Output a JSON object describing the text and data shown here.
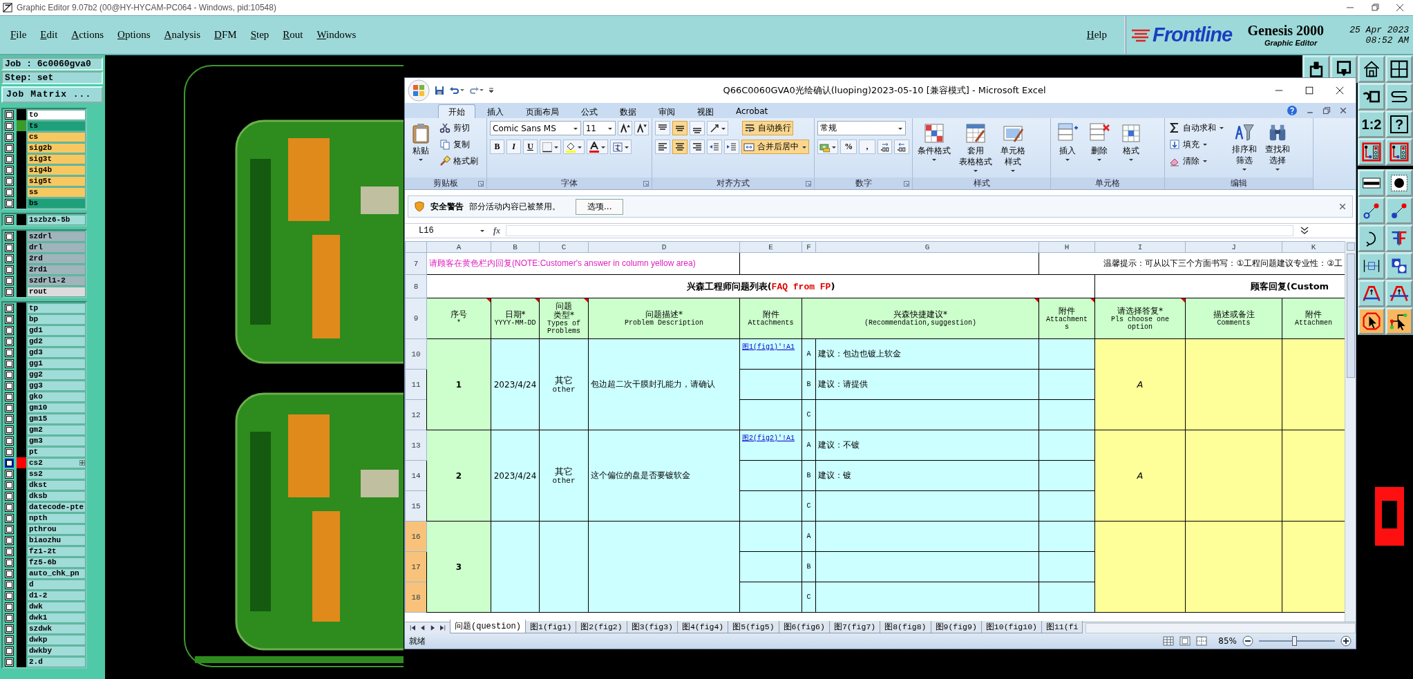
{
  "genesis": {
    "title": "Graphic Editor 9.07b2 (00@HY-HYCAM-PC064 - Windows, pid:10548)",
    "menu": [
      "File",
      "Edit",
      "Actions",
      "Options",
      "Analysis",
      "DFM",
      "Step",
      "Rout",
      "Windows"
    ],
    "help": "Help",
    "brand": {
      "logo": "Frontline",
      "product": "Genesis 2000",
      "subtitle": "Graphic Editor",
      "date": "25 Apr 2023",
      "time": "08:52 AM"
    },
    "job": "Job : 6c0060gva0",
    "step": "Step: set",
    "job_matrix": "Job Matrix ...",
    "layer_groups": [
      [
        {
          "name": "to",
          "color": "#ffffff",
          "checked": false,
          "selected": false
        },
        {
          "name": "ts",
          "color": "#1fa07a",
          "marker": {
            "color": "#3a9a2a"
          },
          "checked": false,
          "selected": false
        },
        {
          "name": "cs",
          "color": "#f8c860",
          "checked": false,
          "selected": false
        },
        {
          "name": "sig2b",
          "color": "#f8c860",
          "checked": false,
          "selected": false
        },
        {
          "name": "sig3t",
          "color": "#f8c860",
          "checked": false,
          "selected": false
        },
        {
          "name": "sig4b",
          "color": "#f8c860",
          "checked": false,
          "selected": false
        },
        {
          "name": "sig5t",
          "color": "#f8c860",
          "checked": false,
          "selected": false
        },
        {
          "name": "ss",
          "color": "#f8c860",
          "checked": false,
          "selected": false
        },
        {
          "name": "bs",
          "color": "#1fa07a",
          "checked": false,
          "selected": false
        }
      ],
      [
        {
          "name": "1szbz6-5b",
          "color": "#a0dcd8",
          "checked": false,
          "selected": false
        }
      ],
      [
        {
          "name": "szdrl",
          "color": "#a0b4bc",
          "checked": false,
          "selected": false
        },
        {
          "name": "drl",
          "color": "#a0b4bc",
          "checked": false,
          "selected": false
        },
        {
          "name": "2rd",
          "color": "#a0b4bc",
          "checked": false,
          "selected": false
        },
        {
          "name": "2rd1",
          "color": "#a0b4bc",
          "checked": false,
          "selected": false
        },
        {
          "name": "szdrl1-2",
          "color": "#a0b4bc",
          "checked": false,
          "selected": false
        },
        {
          "name": "rout",
          "color": "#dcdcdc",
          "checked": false,
          "selected": false
        }
      ],
      [
        {
          "name": "tp",
          "color": "#a0dcd8",
          "checked": false,
          "selected": false
        },
        {
          "name": "bp",
          "color": "#a0dcd8",
          "checked": false,
          "selected": false
        },
        {
          "name": "gd1",
          "color": "#a0dcd8",
          "checked": false,
          "selected": false
        },
        {
          "name": "gd2",
          "color": "#a0dcd8",
          "checked": false,
          "selected": false
        },
        {
          "name": "gd3",
          "color": "#a0dcd8",
          "checked": false,
          "selected": false
        },
        {
          "name": "gg1",
          "color": "#a0dcd8",
          "checked": false,
          "selected": false
        },
        {
          "name": "gg2",
          "color": "#a0dcd8",
          "checked": false,
          "selected": false
        },
        {
          "name": "gg3",
          "color": "#a0dcd8",
          "checked": false,
          "selected": false
        },
        {
          "name": "gko",
          "color": "#a0dcd8",
          "checked": false,
          "selected": false
        },
        {
          "name": "gm10",
          "color": "#a0dcd8",
          "checked": false,
          "selected": false
        },
        {
          "name": "gm15",
          "color": "#a0dcd8",
          "checked": false,
          "selected": false
        },
        {
          "name": "gm2",
          "color": "#a0dcd8",
          "checked": false,
          "selected": false
        },
        {
          "name": "gm3",
          "color": "#a0dcd8",
          "checked": false,
          "selected": false
        },
        {
          "name": "pt",
          "color": "#a0dcd8",
          "checked": false,
          "selected": false
        },
        {
          "name": "cs2",
          "color": "#a0dcd8",
          "marker": {
            "color": "#ff0000"
          },
          "checked": false,
          "selected": true
        },
        {
          "name": "ss2",
          "color": "#a0dcd8",
          "checked": false,
          "selected": false
        },
        {
          "name": "dkst",
          "color": "#a0dcd8",
          "checked": false,
          "selected": false
        },
        {
          "name": "dksb",
          "color": "#a0dcd8",
          "checked": false,
          "selected": false
        },
        {
          "name": "datecode-pte",
          "color": "#a0dcd8",
          "checked": false,
          "selected": false
        },
        {
          "name": "npth",
          "color": "#a0dcd8",
          "checked": false,
          "selected": false
        },
        {
          "name": "pthrou",
          "color": "#a0dcd8",
          "checked": false,
          "selected": false
        },
        {
          "name": "biaozhu",
          "color": "#a0dcd8",
          "checked": false,
          "selected": false
        },
        {
          "name": "fz1-2t",
          "color": "#a0dcd8",
          "checked": false,
          "selected": false
        },
        {
          "name": "fz5-6b",
          "color": "#a0dcd8",
          "checked": false,
          "selected": false
        },
        {
          "name": "auto_chk_pn",
          "color": "#a0dcd8",
          "checked": false,
          "selected": false
        },
        {
          "name": "d",
          "color": "#a0dcd8",
          "checked": false,
          "selected": false
        },
        {
          "name": "d1-2",
          "color": "#a0dcd8",
          "checked": false,
          "selected": false
        },
        {
          "name": "dwk",
          "color": "#a0dcd8",
          "checked": false,
          "selected": false
        },
        {
          "name": "dwk1",
          "color": "#a0dcd8",
          "checked": false,
          "selected": false
        },
        {
          "name": "szdwk",
          "color": "#a0dcd8",
          "checked": false,
          "selected": false
        },
        {
          "name": "dwkp",
          "color": "#a0dcd8",
          "checked": false,
          "selected": false
        },
        {
          "name": "dwkby",
          "color": "#a0dcd8",
          "checked": false,
          "selected": false
        },
        {
          "name": "2.d",
          "color": "#a0dcd8",
          "checked": false,
          "selected": false
        }
      ]
    ],
    "tools": [
      [
        {
          "kind": "export",
          "active": false
        },
        {
          "kind": "import",
          "active": false
        },
        {
          "kind": "house",
          "active": false
        },
        {
          "kind": "grid",
          "active": false
        }
      ],
      [
        {
          "kind": "undo",
          "active": false
        },
        {
          "kind": "curve",
          "active": false
        }
      ],
      [
        {
          "kind": "ratio",
          "label": "1:2",
          "active": false
        },
        {
          "kind": "help",
          "label": "?",
          "active": false
        }
      ],
      [
        {
          "kind": "circuit",
          "active": false
        },
        {
          "kind": "circuit",
          "active": false
        }
      ],
      [
        {
          "kind": "ruler",
          "active": false
        },
        {
          "kind": "dot",
          "active": false
        }
      ],
      [
        {
          "kind": "link_open",
          "active": false
        },
        {
          "kind": "link_filled",
          "active": false
        }
      ],
      [
        {
          "kind": "return",
          "active": false
        },
        {
          "kind": "flip",
          "active": false
        }
      ],
      [
        {
          "kind": "measure",
          "active": false
        },
        {
          "kind": "shapes",
          "active": false
        }
      ],
      [
        {
          "kind": "arch",
          "active": false
        },
        {
          "kind": "arch_line",
          "active": false
        }
      ],
      [
        {
          "kind": "pointer",
          "active": true
        },
        {
          "kind": "route_pointer",
          "active": true
        }
      ]
    ]
  },
  "excel": {
    "title": "Q66C0060GVA0光绘确认(luoping)2023-05-10  [兼容模式] - Microsoft Excel",
    "tabs": [
      {
        "label": "开始",
        "selected": true
      },
      {
        "label": "插入",
        "selected": false
      },
      {
        "label": "页面布局",
        "selected": false
      },
      {
        "label": "公式",
        "selected": false
      },
      {
        "label": "数据",
        "selected": false
      },
      {
        "label": "审阅",
        "selected": false
      },
      {
        "label": "视图",
        "selected": false
      },
      {
        "label": "Acrobat",
        "selected": false
      }
    ],
    "ribbon": [
      {
        "kind": "clipboard",
        "label": "剪贴板",
        "launcher": true,
        "big": "粘贴",
        "items": [
          "剪切",
          "复制",
          "格式刷"
        ]
      },
      {
        "kind": "font",
        "label": "字体",
        "launcher": true,
        "font": "Comic Sans MS",
        "size": "11",
        "styles": [
          "B",
          "I",
          "U"
        ]
      },
      {
        "kind": "alignment",
        "label": "对齐方式",
        "launcher": true,
        "wrap": "自动换行",
        "merge": "合并后居中"
      },
      {
        "kind": "number",
        "label": "数字",
        "launcher": true,
        "format": "常规",
        "symbols": [
          "%",
          ","
        ]
      },
      {
        "kind": "styles",
        "label": "样式",
        "launcher": false,
        "items": [
          [
            "条件格式"
          ],
          [
            "套用",
            "表格格式"
          ],
          [
            "单元格",
            "样式"
          ]
        ]
      },
      {
        "kind": "cells",
        "label": "单元格",
        "launcher": false,
        "items": [
          "插入",
          "删除",
          "格式"
        ]
      },
      {
        "kind": "editing",
        "label": "编辑",
        "launcher": false,
        "small": [
          "自动求和",
          "填充",
          "清除"
        ],
        "big": [
          [
            "排序和",
            "筛选"
          ],
          [
            "查找和",
            "选择"
          ]
        ]
      }
    ],
    "security": {
      "title": "安全警告",
      "message": "部分活动内容已被禁用。",
      "button": "选项..."
    },
    "formula": {
      "name_box": "L16",
      "fx": "fx"
    },
    "columns": [
      "A",
      "B",
      "C",
      "D",
      "E",
      "F",
      "G",
      "H",
      "I",
      "J",
      "K"
    ],
    "rows": [
      {
        "label": "7",
        "selected": false
      },
      {
        "label": "8",
        "selected": false
      },
      {
        "label": "9",
        "selected": false
      },
      {
        "label": "10",
        "selected": false
      },
      {
        "label": "11",
        "selected": false
      },
      {
        "label": "12",
        "selected": false
      },
      {
        "label": "13",
        "selected": false
      },
      {
        "label": "14",
        "selected": false
      },
      {
        "label": "15",
        "selected": false
      },
      {
        "label": "16",
        "selected": true
      },
      {
        "label": "17",
        "selected": true
      },
      {
        "label": "18",
        "selected": true
      }
    ],
    "notice": "请顾客在黄色栏内回复(NOTE:Customer's answer in column yellow area)",
    "tip": "温馨提示：可从以下三个方面书写：①工程问题建议专业性：②工",
    "section_title": [
      {
        "kind": "plain",
        "text": "兴森工程师问题列表("
      },
      {
        "kind": "highlight",
        "text": "FAQ from FP"
      },
      {
        "kind": "plain",
        "text": ")"
      }
    ],
    "customer_title": "顾客回复(Custom",
    "headers": [
      {
        "lines": [
          "序号",
          "*"
        ],
        "comment": true
      },
      {
        "lines": [
          "日期*",
          "YYYY-MM-DD"
        ],
        "comment": true
      },
      {
        "lines": [
          "问题",
          "类型*",
          "Types of",
          "Problems"
        ],
        "comment": true
      },
      {
        "lines": [
          "问题描述*",
          "Problem Description"
        ],
        "comment": false
      },
      {
        "lines": [
          "附件",
          "Attachments"
        ],
        "comment": false
      },
      {
        "lines": [
          "兴森快捷建议*",
          "(Recommendation,suggestion)"
        ],
        "comment": true
      },
      {
        "lines": [
          "附件",
          "Attachment",
          "s"
        ],
        "comment": true
      },
      {
        "lines": [
          "请选择答复*",
          "Pls choose one option"
        ],
        "comment": true
      },
      {
        "lines": [
          "描述或备注",
          "Comments"
        ],
        "comment": false
      },
      {
        "lines": [
          "附件",
          "Attachmen"
        ],
        "comment": false
      }
    ],
    "questions": [
      {
        "no": "1",
        "date": "2023/4/24",
        "type": [
          "其它",
          "other"
        ],
        "description": "包边超二次干膜封孔能力，请确认",
        "answer": "A",
        "options": [
          {
            "letter": "A",
            "attachment": "图1(fig1)'!A1",
            "suggestion": "建议：包边也镀上软金"
          },
          {
            "letter": "B",
            "suggestion": "建议：请提供"
          },
          {
            "letter": "C"
          }
        ]
      },
      {
        "no": "2",
        "date": "2023/4/24",
        "type": [
          "其它",
          "other"
        ],
        "description": "这个偏位的盘是否要镀软金",
        "answer": "A",
        "options": [
          {
            "letter": "A",
            "attachment": "图2(fig2)'!A1",
            "suggestion": "建议：不镀"
          },
          {
            "letter": "B",
            "suggestion": "建议：镀"
          },
          {
            "letter": "C"
          }
        ]
      },
      {
        "no": "3",
        "options": [
          {
            "letter": "A"
          },
          {
            "letter": "B"
          },
          {
            "letter": "C"
          }
        ]
      }
    ],
    "sheet_tabs": [
      {
        "label": "问题(question)",
        "selected": true
      },
      {
        "label": "图1(fig1)",
        "selected": false
      },
      {
        "label": "图2(fig2)",
        "selected": false
      },
      {
        "label": "图3(fig3)",
        "selected": false
      },
      {
        "label": "图4(fig4)",
        "selected": false
      },
      {
        "label": "图5(fig5)",
        "selected": false
      },
      {
        "label": "图6(fig6)",
        "selected": false
      },
      {
        "label": "图7(fig7)",
        "selected": false
      },
      {
        "label": "图8(fig8)",
        "selected": false
      },
      {
        "label": "图9(fig9)",
        "selected": false
      },
      {
        "label": "图10(fig10)",
        "selected": false
      },
      {
        "label": "图11(fi",
        "selected": false
      }
    ],
    "status": {
      "text": "就绪",
      "zoom": "85%",
      "level": 0.46
    }
  }
}
